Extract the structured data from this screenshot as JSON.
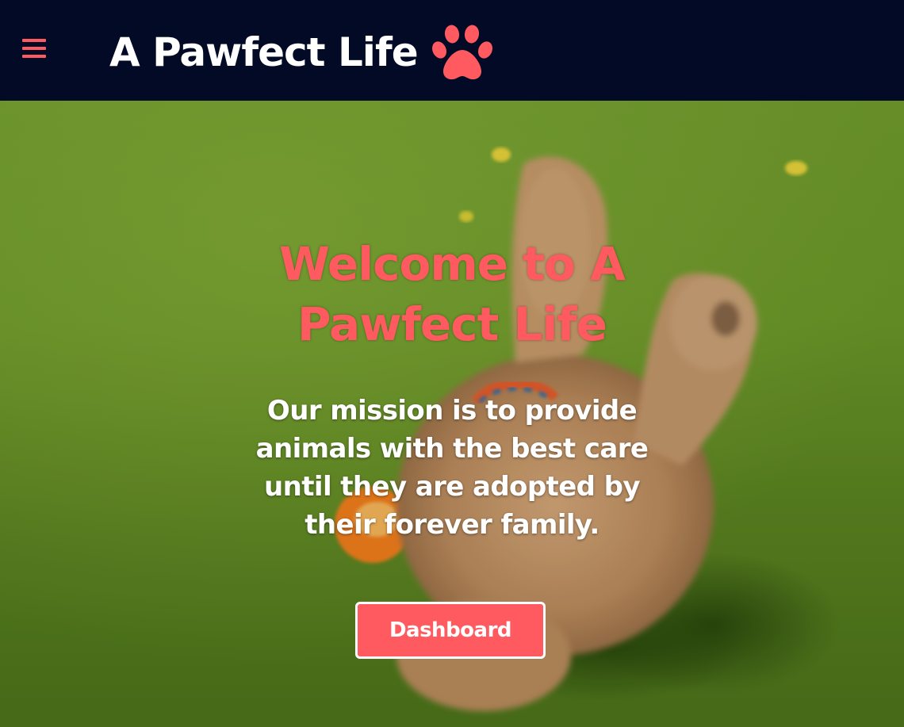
{
  "navbar": {
    "menu_icon": "hamburger-menu-icon",
    "brand_title": "A Pawfect Life",
    "brand_icon": "paw-print-icon",
    "background_color": "#030a26",
    "accent_color": "#ff5a5f"
  },
  "hero": {
    "title": "Welcome to A Pawfect Life",
    "subtitle": "Our mission is to provide animals with the best care until they are adopted by their forever family.",
    "button_label": "Dashboard"
  }
}
